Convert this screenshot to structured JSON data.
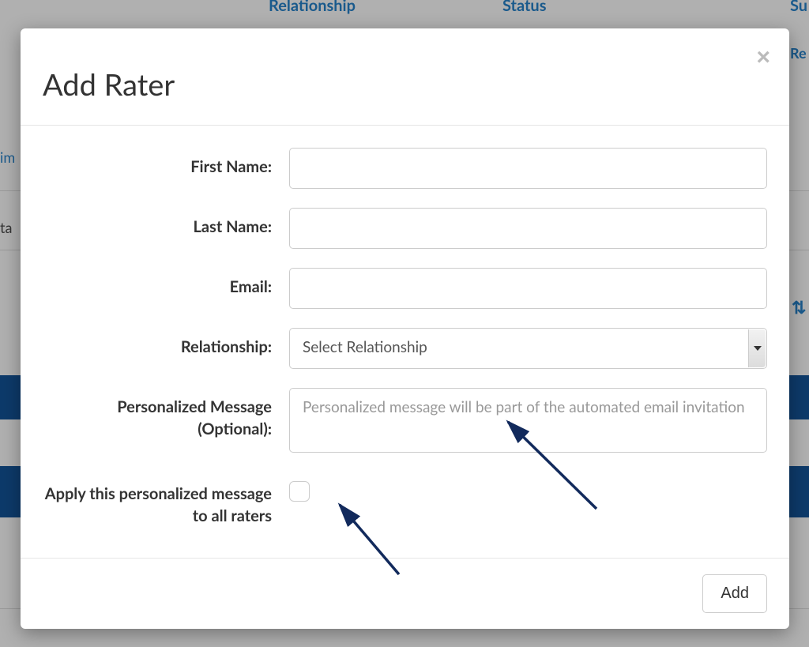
{
  "background": {
    "tab_relationship": "Relationship",
    "tab_status": "Status",
    "tab_su": "Su",
    "link_re": "Re",
    "link_im": "im",
    "txt_ta": "ta",
    "sort_glyph": "⇅"
  },
  "modal": {
    "title": "Add Rater",
    "close_glyph": "×",
    "fields": {
      "first_name_label": "First Name:",
      "first_name_value": "",
      "last_name_label": "Last Name:",
      "last_name_value": "",
      "email_label": "Email:",
      "email_value": "",
      "relationship_label": "Relationship:",
      "relationship_selected": "Select Relationship",
      "message_label": "Personalized Message (Optional):",
      "message_placeholder": "Personalized message will be part of the automated email invitation",
      "message_value": "",
      "apply_all_label": "Apply this personalized message to all raters",
      "apply_all_checked": false
    },
    "footer": {
      "add_label": "Add"
    }
  }
}
